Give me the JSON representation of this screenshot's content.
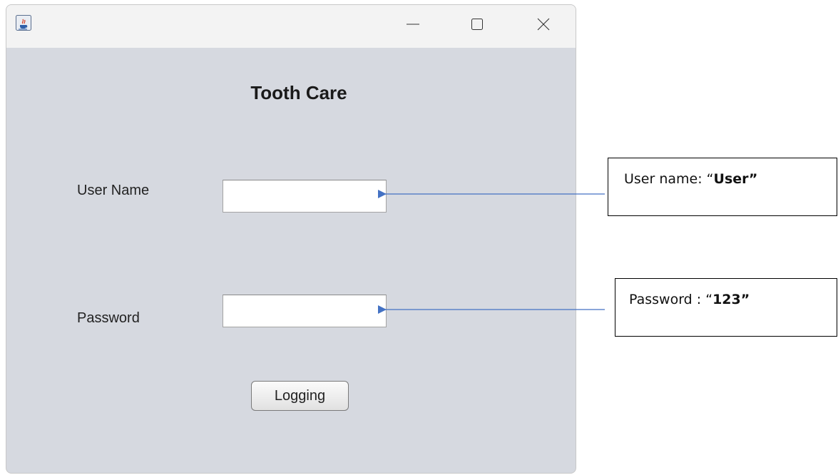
{
  "window": {
    "app_icon": "java-coffee-cup-icon",
    "controls": {
      "minimize_icon": "minimize-icon",
      "maximize_icon": "maximize-icon",
      "close_icon": "close-icon"
    }
  },
  "form": {
    "title": "Tooth Care",
    "username_label": "User Name",
    "username_value": "",
    "password_label": "Password",
    "password_value": "",
    "login_button": "Logging"
  },
  "annotations": {
    "username_prefix": "User name: “",
    "username_hint": "User”",
    "password_prefix": "Password : “",
    "password_hint": "123”",
    "arrow_color": "#4472c4"
  },
  "colors": {
    "window_bg": "#d6d9e0",
    "titlebar_bg": "#f3f3f3"
  }
}
